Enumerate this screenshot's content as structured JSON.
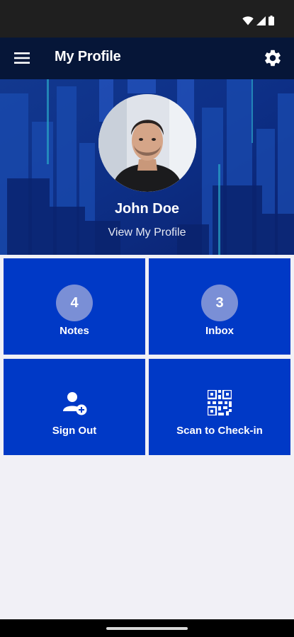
{
  "app_bar": {
    "title": "My Profile",
    "menu_icon": "hamburger-menu-icon",
    "settings_icon": "gear-icon"
  },
  "profile": {
    "name": "John Doe",
    "view_link": "View My Profile"
  },
  "tiles": [
    {
      "label": "Notes",
      "count": "4"
    },
    {
      "label": "Inbox",
      "count": "3"
    },
    {
      "label": "Sign Out",
      "icon": "user-add-icon"
    },
    {
      "label": "Scan to Check-in",
      "icon": "qr-code-icon"
    }
  ],
  "colors": {
    "status_bar": "#1f1f1f",
    "app_bar": "#061638",
    "tile": "#0039c6",
    "badge": "#7a8fd6",
    "background": "#f1f0f6"
  }
}
